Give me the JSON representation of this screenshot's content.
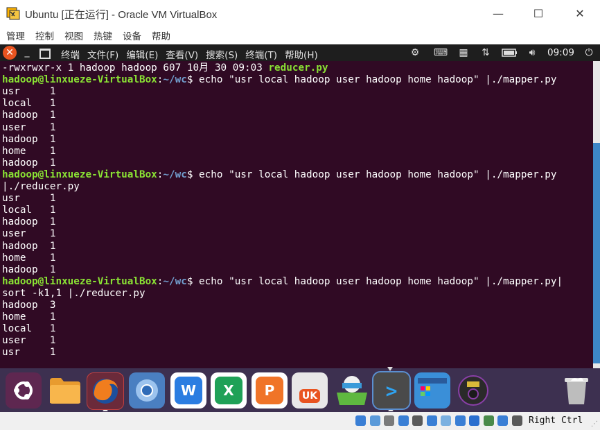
{
  "window": {
    "title": "Ubuntu [正在运行] - Oracle VM VirtualBox",
    "min_glyph": "—",
    "max_glyph": "☐",
    "close_glyph": "✕"
  },
  "vbox_menu": [
    "管理",
    "控制",
    "视图",
    "热键",
    "设备",
    "帮助"
  ],
  "ubuntu_panel": {
    "close_glyph": "✕",
    "menu": [
      "终端",
      "文件(F)",
      "编辑(E)",
      "查看(V)",
      "搜索(S)",
      "终端(T)",
      "帮助(H)"
    ],
    "clock": "09:09",
    "tray_icons": [
      "settings-icon",
      "keyboard-icon",
      "input-method-icon",
      "network-icon",
      "battery-icon",
      "volume-icon",
      "power-icon"
    ]
  },
  "terminal": {
    "prompt_user": "hadoop@linxueze-VirtualBox",
    "prompt_path": "~/wc",
    "lines": [
      {
        "kind": "ls",
        "text": "-rwxrwxr-x 1 hadoop hadoop 607 10月 30 09:03 ",
        "file": "reducer.py"
      },
      {
        "kind": "prompt",
        "cmd": "$ echo \"usr local hadoop user hadoop home hadoop\" |./mapper.py"
      },
      {
        "kind": "out",
        "text": "usr     1"
      },
      {
        "kind": "out",
        "text": "local   1"
      },
      {
        "kind": "out",
        "text": "hadoop  1"
      },
      {
        "kind": "out",
        "text": "user    1"
      },
      {
        "kind": "out",
        "text": "hadoop  1"
      },
      {
        "kind": "out",
        "text": "home    1"
      },
      {
        "kind": "out",
        "text": "hadoop  1"
      },
      {
        "kind": "prompt",
        "cmd": "$ echo \"usr local hadoop user hadoop home hadoop\" |./mapper.py"
      },
      {
        "kind": "out",
        "text": "|./reducer.py"
      },
      {
        "kind": "out",
        "text": "usr     1"
      },
      {
        "kind": "out",
        "text": "local   1"
      },
      {
        "kind": "out",
        "text": "hadoop  1"
      },
      {
        "kind": "out",
        "text": "user    1"
      },
      {
        "kind": "out",
        "text": "hadoop  1"
      },
      {
        "kind": "out",
        "text": "home    1"
      },
      {
        "kind": "out",
        "text": "hadoop  1"
      },
      {
        "kind": "prompt",
        "cmd": "$ echo \"usr local hadoop user hadoop home hadoop\" |./mapper.py|"
      },
      {
        "kind": "out",
        "text": "sort -k1,1 |./reducer.py"
      },
      {
        "kind": "out",
        "text": "hadoop  3"
      },
      {
        "kind": "out",
        "text": "home    1"
      },
      {
        "kind": "out",
        "text": "local   1"
      },
      {
        "kind": "out",
        "text": "user    1"
      },
      {
        "kind": "out",
        "text": "usr     1"
      }
    ]
  },
  "dock": {
    "apps": [
      {
        "name": "ubuntu-dash-icon",
        "bg": "#5e2750",
        "label": ""
      },
      {
        "name": "files-icon",
        "bg": "#f5a742",
        "label": ""
      },
      {
        "name": "firefox-icon",
        "bg": "#c0392b",
        "label": ""
      },
      {
        "name": "chromium-icon",
        "bg": "#4a7fc1",
        "label": ""
      },
      {
        "name": "wps-writer-icon",
        "bg": "#2b7de1",
        "label": "W"
      },
      {
        "name": "wps-spreadsheet-icon",
        "bg": "#1fa157",
        "label": "X"
      },
      {
        "name": "wps-presentation-icon",
        "bg": "#f07428",
        "label": "P"
      },
      {
        "name": "ubuntu-kylin-store-icon",
        "bg": "#e8e8e8",
        "label": "UK"
      },
      {
        "name": "software-updater-icon",
        "bg": "#5fb840",
        "label": ""
      },
      {
        "name": "terminal-icon",
        "bg": "#4d4d4d",
        "label": ">"
      },
      {
        "name": "workspace-switcher-icon",
        "bg": "#3a8fd8",
        "label": ""
      },
      {
        "name": "dvd-icon",
        "bg": "#2a2a2a",
        "label": ""
      },
      {
        "name": "trash-icon",
        "bg": "#3d3050",
        "label": ""
      }
    ]
  },
  "statusbar": {
    "host_key": "Right Ctrl",
    "icons": [
      "hard-disk-icon",
      "optical-drive-icon",
      "audio-icon",
      "network-icon",
      "usb-icon",
      "shared-folders-icon",
      "display-icon",
      "video-capture-icon",
      "cpu-icon",
      "mouse-integration-icon",
      "keyboard-capture-icon",
      "arrow-down-icon"
    ]
  }
}
